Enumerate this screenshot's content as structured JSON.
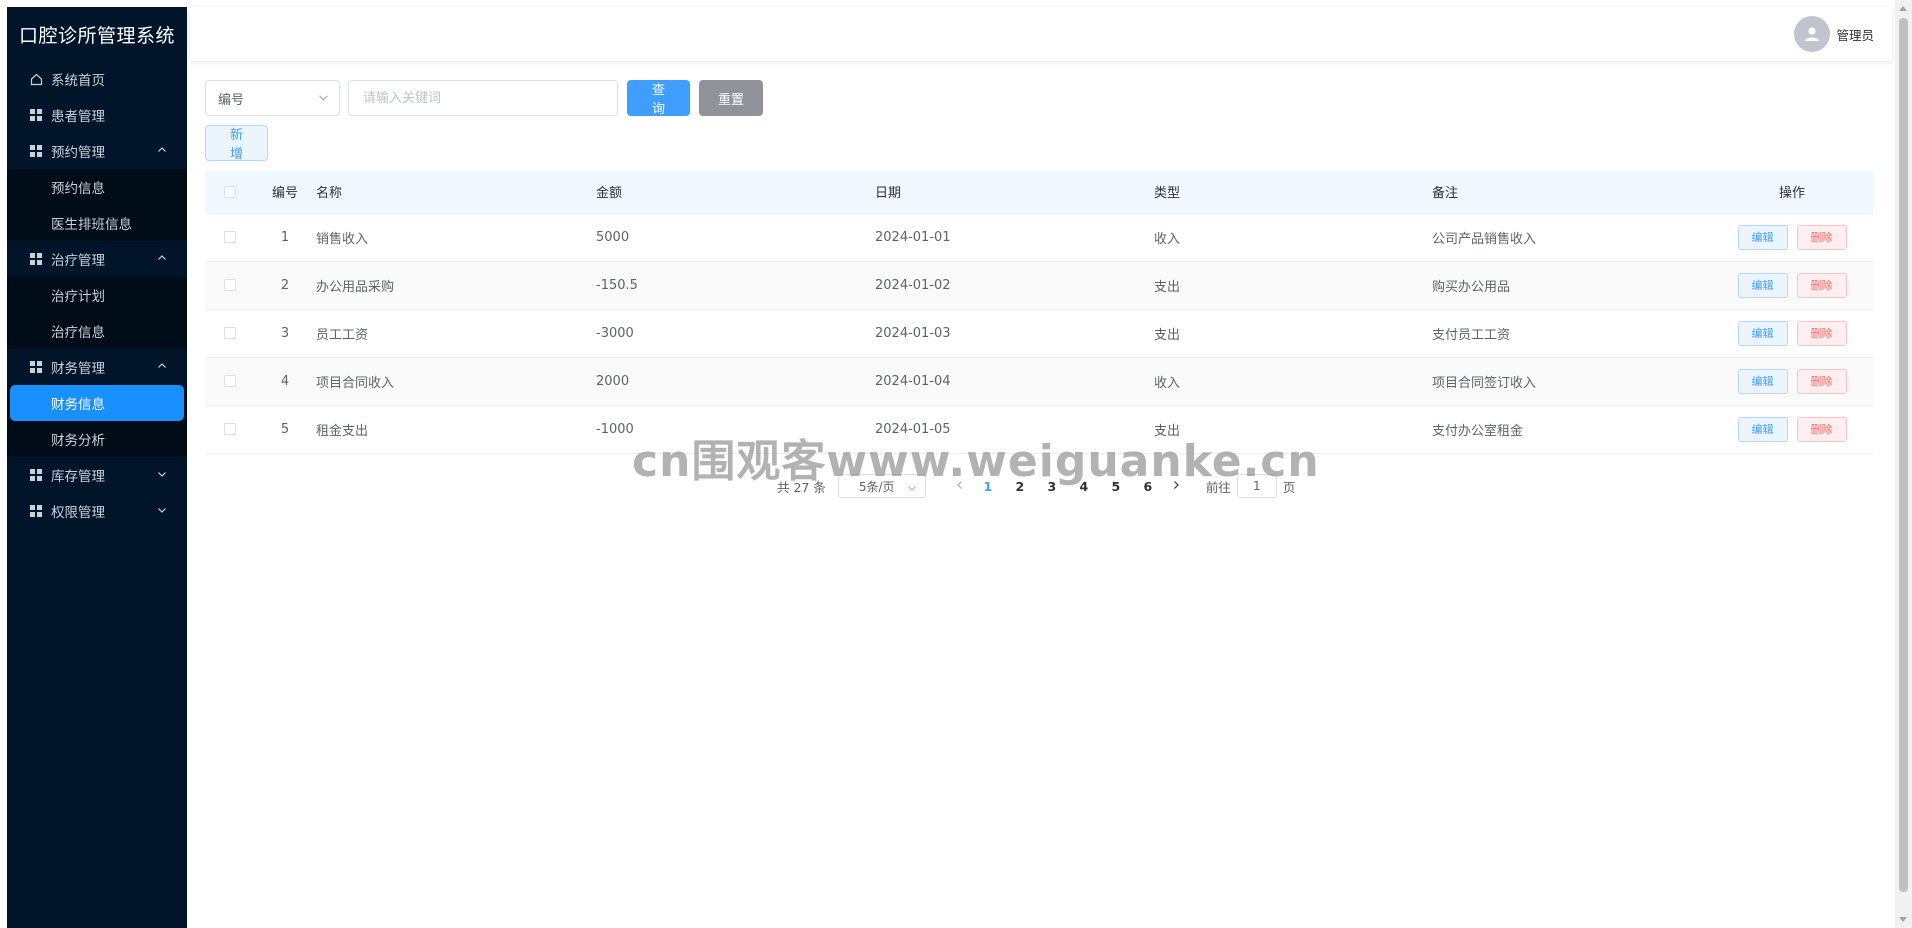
{
  "app_title": "口腔诊所管理系统",
  "sidebar": {
    "items": [
      {
        "label": "系统首页"
      },
      {
        "label": "患者管理"
      },
      {
        "label": "预约管理",
        "children": [
          {
            "label": "预约信息"
          },
          {
            "label": "医生排班信息"
          }
        ]
      },
      {
        "label": "治疗管理",
        "children": [
          {
            "label": "治疗计划"
          },
          {
            "label": "治疗信息"
          }
        ]
      },
      {
        "label": "财务管理",
        "children": [
          {
            "label": "财务信息"
          },
          {
            "label": "财务分析"
          }
        ]
      },
      {
        "label": "库存管理"
      },
      {
        "label": "权限管理"
      }
    ]
  },
  "header": {
    "user_name": "管理员"
  },
  "toolbar": {
    "filter_field": "编号",
    "search_placeholder": "请输入关键词",
    "query_label": "查询",
    "reset_label": "重置",
    "add_label": "新增"
  },
  "table": {
    "columns": [
      "编号",
      "名称",
      "金额",
      "日期",
      "类型",
      "备注",
      "操作"
    ],
    "edit_label": "编辑",
    "delete_label": "删除",
    "rows": [
      {
        "id": "1",
        "name": "销售收入",
        "amount": "5000",
        "date": "2024-01-01",
        "type": "收入",
        "note": "公司产品销售收入"
      },
      {
        "id": "2",
        "name": "办公用品采购",
        "amount": "-150.5",
        "date": "2024-01-02",
        "type": "支出",
        "note": "购买办公用品"
      },
      {
        "id": "3",
        "name": "员工工资",
        "amount": "-3000",
        "date": "2024-01-03",
        "type": "支出",
        "note": "支付员工工资"
      },
      {
        "id": "4",
        "name": "项目合同收入",
        "amount": "2000",
        "date": "2024-01-04",
        "type": "收入",
        "note": "项目合同签订收入"
      },
      {
        "id": "5",
        "name": "租金支出",
        "amount": "-1000",
        "date": "2024-01-05",
        "type": "支出",
        "note": "支付办公室租金"
      }
    ]
  },
  "pagination": {
    "total_text": "共 27 条",
    "page_size": "5条/页",
    "pages": [
      "1",
      "2",
      "3",
      "4",
      "5",
      "6"
    ],
    "current": "1",
    "goto_prefix": "前往",
    "goto_value": "1",
    "goto_suffix": "页"
  },
  "watermark": "cn围观客www.weiguanke.cn",
  "colors": {
    "sidebar_bg": "#001529",
    "submenu_bg": "#000c17",
    "active": "#1890ff",
    "primary": "#409eff",
    "danger": "#f56c6c",
    "info": "#909399"
  }
}
